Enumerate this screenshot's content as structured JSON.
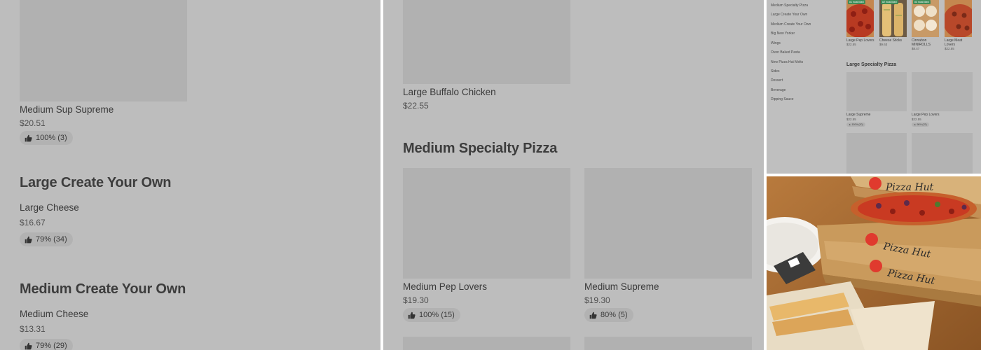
{
  "panel1": {
    "sup_supreme": {
      "name": "Medium Sup Supreme",
      "price": "$20.51",
      "rating": "100% (3)"
    },
    "section_large_cyo": "Large Create Your Own",
    "large_cheese": {
      "name": "Large Cheese",
      "price": "$16.67",
      "rating": "79% (34)"
    },
    "section_medium_cyo": "Medium Create Your Own",
    "medium_cheese": {
      "name": "Medium Cheese",
      "price": "$13.31",
      "rating": "79% (29)"
    }
  },
  "panel2": {
    "buffalo": {
      "name": "Large Buffalo Chicken",
      "price": "$22.55"
    },
    "section_medium_specialty": "Medium Specialty Pizza",
    "pep_lovers": {
      "name": "Medium Pep Lovers",
      "price": "$19.30",
      "rating": "100% (15)"
    },
    "supreme": {
      "name": "Medium Supreme",
      "price": "$19.30",
      "rating": "80% (5)"
    }
  },
  "panel3": {
    "sidebar": [
      "Medium Specialty Pizza",
      "Large Create Your Own",
      "Medium Create Your Own",
      "Big New Yorker",
      "Wings",
      "Oven Baked Pasta",
      "New Pizza Hut Melts",
      "Sides",
      "Dessert",
      "Beverage",
      "Dipping Sauce"
    ],
    "top_items": [
      {
        "tag": "#1 most liked",
        "name": "Large Pep Lovers",
        "price": "$22.55"
      },
      {
        "tag": "#2 most liked",
        "name": "Cheese Sticks",
        "price": "$9.63"
      },
      {
        "tag": "#3 most liked",
        "name": "Cinnabon MINIROLLS",
        "price": "$8.47"
      },
      {
        "tag": "",
        "name": "Large Meat Lovers",
        "price": "$22.55"
      }
    ],
    "section_large_specialty": "Large Specialty Pizza",
    "grid_items": [
      {
        "name": "Large Supreme",
        "price": "$22.55",
        "rating": "100% (20)"
      },
      {
        "name": "Large Pep Lovers",
        "price": "$22.55",
        "rating": "96% (22)"
      }
    ]
  },
  "panel4": {
    "brand": "Pizza Hut"
  },
  "colors": {
    "panel_gray": "#bdbdbd",
    "placeholder_gray": "#b1b1b1",
    "tag_green": "#3f8b57",
    "brand_red": "#e03a2e"
  }
}
